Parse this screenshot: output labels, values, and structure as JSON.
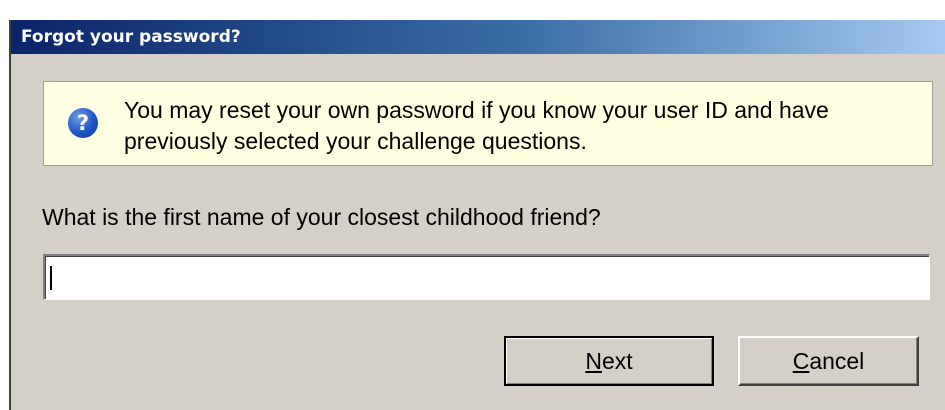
{
  "window": {
    "title": "Forgot your password?"
  },
  "info": {
    "icon": "help-question-icon",
    "message": "You may reset your own password if you know your user ID and have previously selected your challenge questions."
  },
  "question": {
    "label": "What is the first name of your closest childhood friend?",
    "value": "",
    "placeholder": ""
  },
  "buttons": {
    "next_mnemonic": "N",
    "next_rest": "ext",
    "cancel_mnemonic": "C",
    "cancel_rest": "ancel"
  },
  "colors": {
    "title_bar_start": "#0a246a",
    "title_bar_end": "#a6caf0",
    "dialog_face": "#d4d0c8",
    "info_background": "#ffffe1",
    "help_icon": "#1f56c4"
  }
}
